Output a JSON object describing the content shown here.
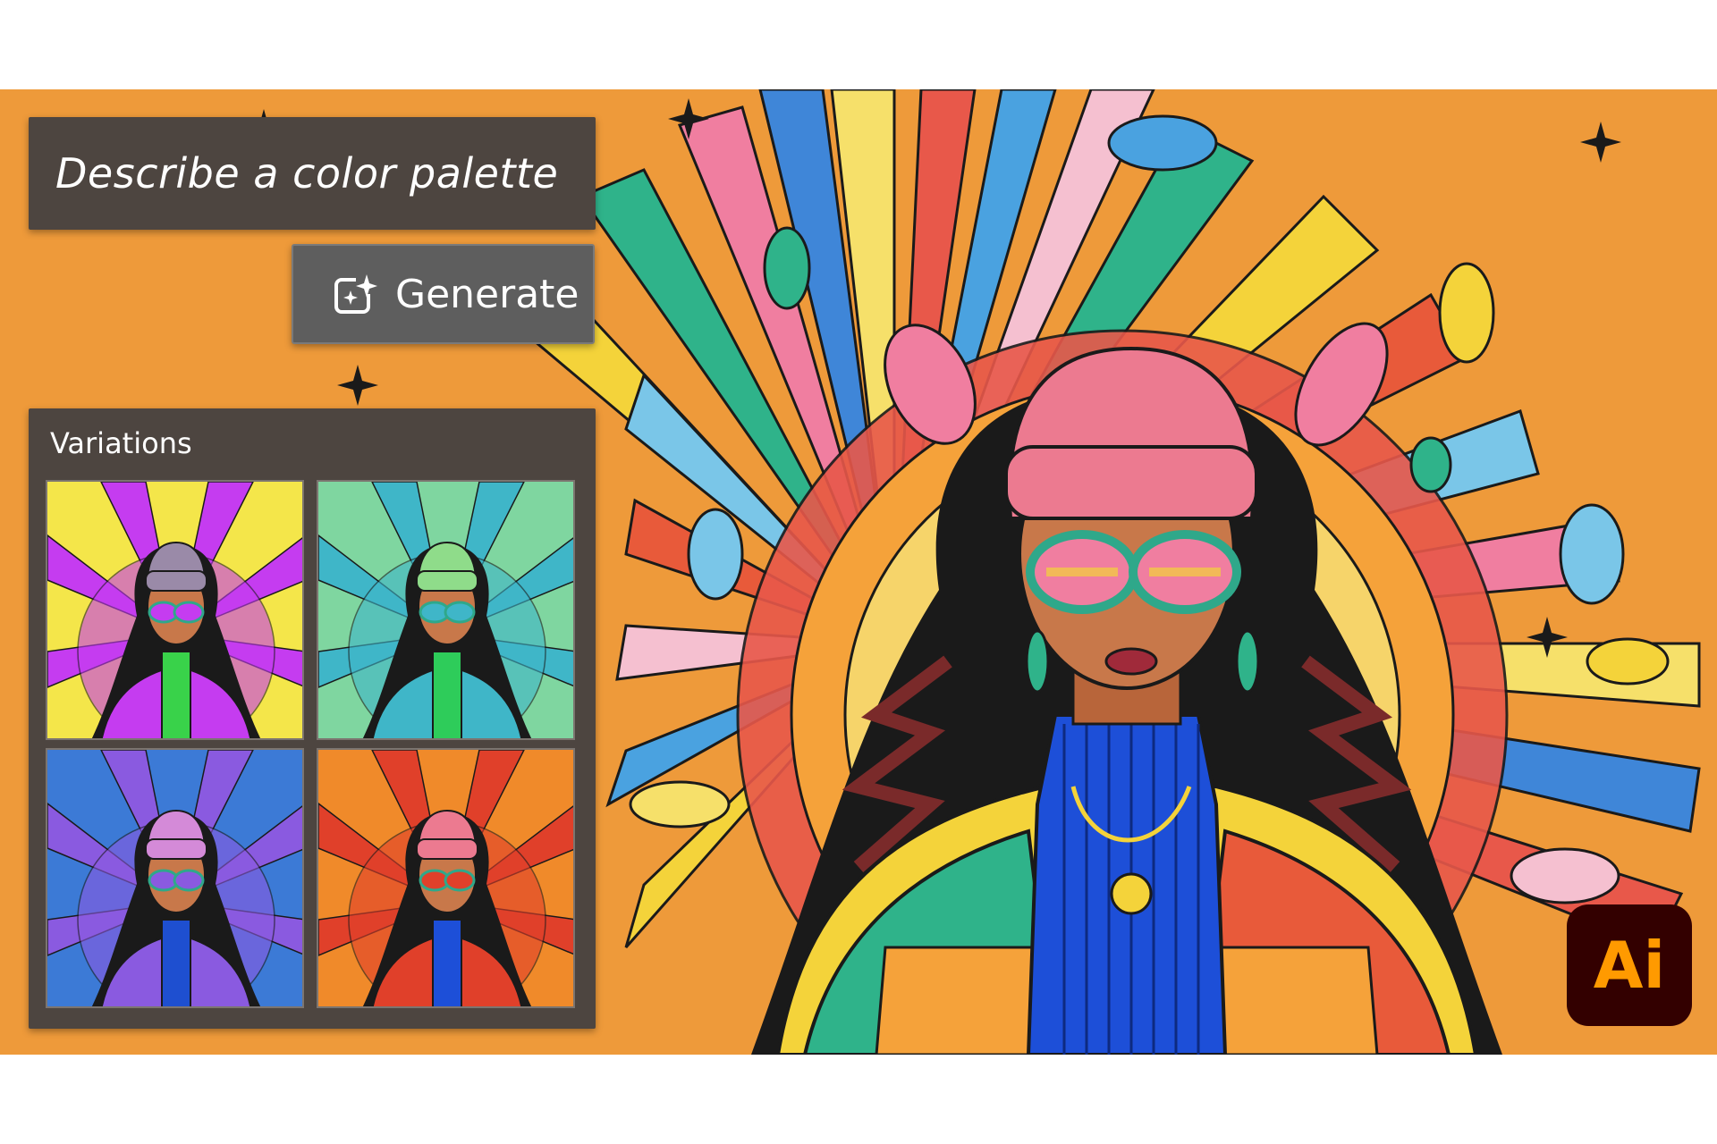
{
  "prompt": {
    "text": "Describe a color palette"
  },
  "generate_button": {
    "label": "Generate",
    "icon": "sparkle-frame-icon"
  },
  "variations": {
    "title": "Variations",
    "items": [
      {
        "palette": "yellow-magenta",
        "bg": "#f4e64a",
        "accent": "#c53cf0",
        "hat": "#9a8aa8",
        "sweater": "#39d24a"
      },
      {
        "palette": "mint-green",
        "bg": "#7fd6a0",
        "accent": "#3fb6c8",
        "hat": "#8fdc8a",
        "sweater": "#2ecc5a"
      },
      {
        "palette": "blue-violet",
        "bg": "#3c7ad6",
        "accent": "#8a5ae0",
        "hat": "#d48ad8",
        "sweater": "#1e4fd0"
      },
      {
        "palette": "orange-original",
        "bg": "#f08a2a",
        "accent": "#e0402a",
        "hat": "#ec7a90",
        "sweater": "#1d4fd8"
      }
    ]
  },
  "app_logo": {
    "text": "Ai"
  },
  "colors": {
    "canvas_bg": "#ee9a3a",
    "panel_bg": "#4d4540",
    "button_bg": "#5e5e5e",
    "logo_bg": "#330000",
    "logo_text": "#ff9a00"
  }
}
